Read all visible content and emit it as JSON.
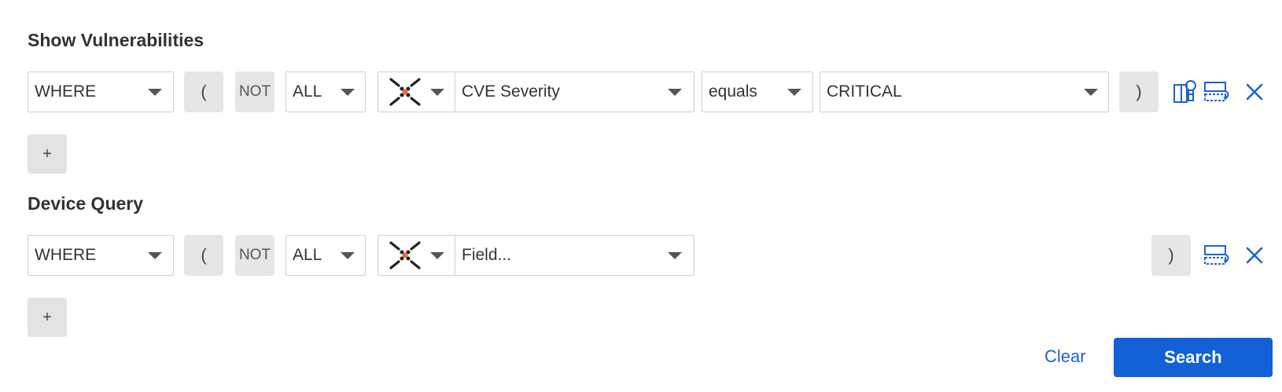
{
  "sections": [
    {
      "title": "Show Vulnerabilities",
      "row": {
        "where": "WHERE",
        "open_paren": "(",
        "not": "NOT",
        "all": "ALL",
        "adapter_icon": "adapter-cross-icon",
        "field": "CVE Severity",
        "operator": "equals",
        "value": "CRITICAL",
        "close_paren": ")",
        "icons": [
          "filter-settings-icon",
          "duplicate-row-icon",
          "close-icon"
        ]
      },
      "add_label": "+"
    },
    {
      "title": "Device Query",
      "row": {
        "where": "WHERE",
        "open_paren": "(",
        "not": "NOT",
        "all": "ALL",
        "adapter_icon": "adapter-cross-icon",
        "field_placeholder": "Field...",
        "close_paren": ")",
        "icons": [
          "duplicate-row-icon",
          "close-icon"
        ]
      },
      "add_label": "+"
    }
  ],
  "actions": {
    "clear_label": "Clear",
    "search_label": "Search"
  },
  "colors": {
    "accent": "#1261d6",
    "adapter_dot": "#f06a3a",
    "button_gray": "#e6e6e6"
  }
}
